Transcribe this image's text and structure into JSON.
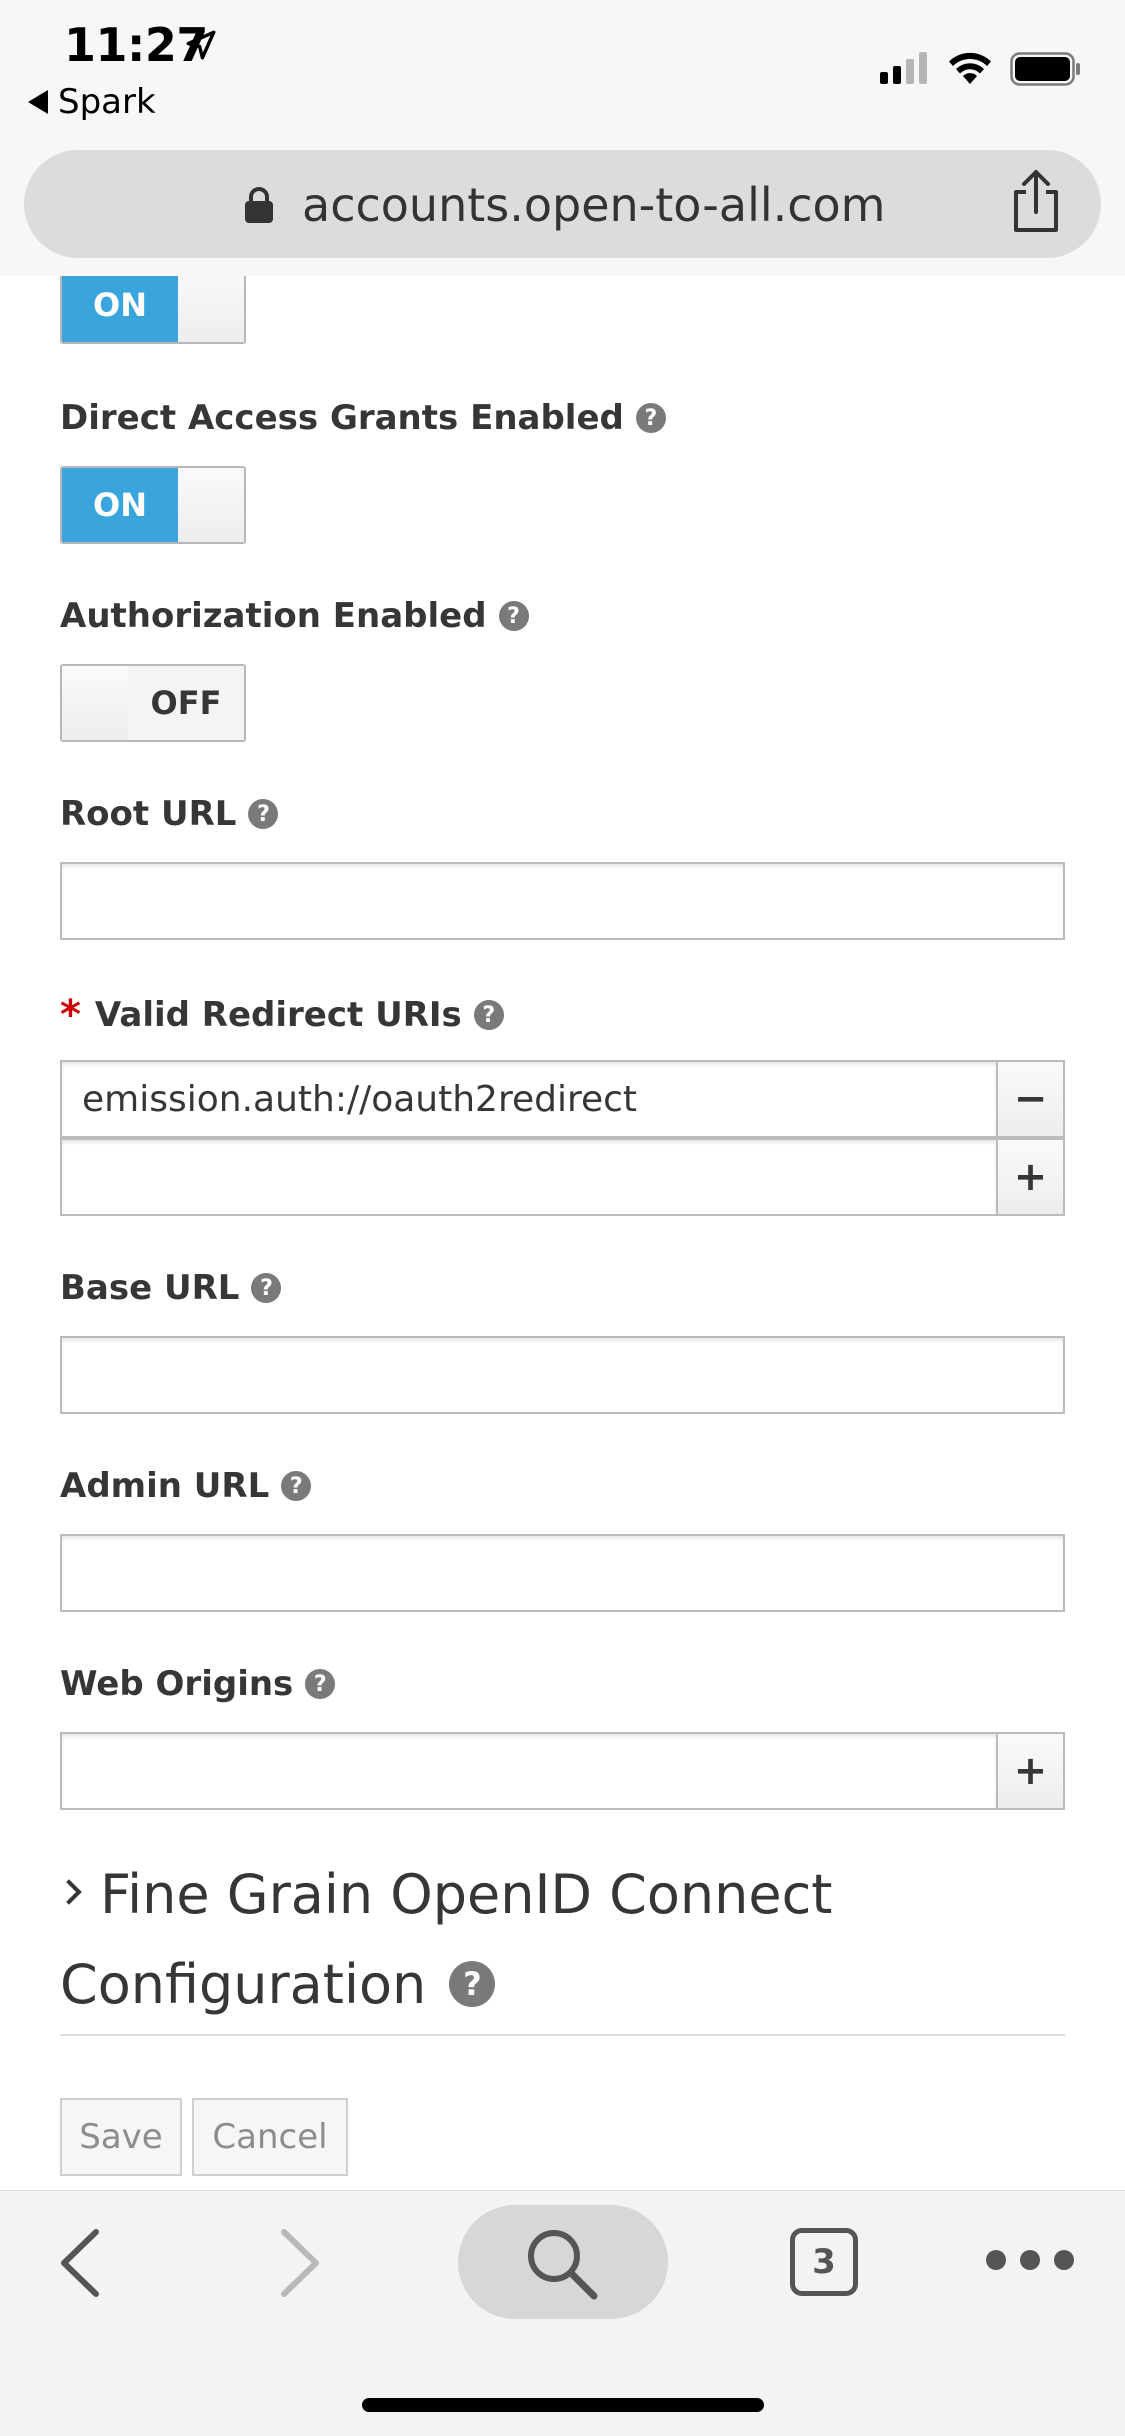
{
  "status_bar": {
    "time": "11:27",
    "back_app": "Spark"
  },
  "browser": {
    "url": "accounts.open-to-all.com",
    "tab_count": "3"
  },
  "form": {
    "top_toggle": {
      "state": "ON"
    },
    "direct_access": {
      "label": "Direct Access Grants Enabled",
      "state": "ON"
    },
    "authorization": {
      "label": "Authorization Enabled",
      "state": "OFF"
    },
    "root_url": {
      "label": "Root URL",
      "value": ""
    },
    "redirect_uris": {
      "required_mark": "*",
      "label": "Valid Redirect URIs",
      "values": [
        "emission.auth://oauth2redirect",
        ""
      ],
      "remove_symbol": "−",
      "add_symbol": "+"
    },
    "base_url": {
      "label": "Base URL",
      "value": ""
    },
    "admin_url": {
      "label": "Admin URL",
      "value": ""
    },
    "web_origins": {
      "label": "Web Origins",
      "value": "",
      "add_symbol": "+"
    },
    "fine_grain": {
      "title_line1": "Fine Grain OpenID Connect",
      "title_line2": "Configuration"
    },
    "help_glyph": "?",
    "buttons": {
      "save": "Save",
      "cancel": "Cancel"
    }
  },
  "colors": {
    "toggle_on": "#39a5dc",
    "required": "#cc0000",
    "text": "#363636"
  }
}
